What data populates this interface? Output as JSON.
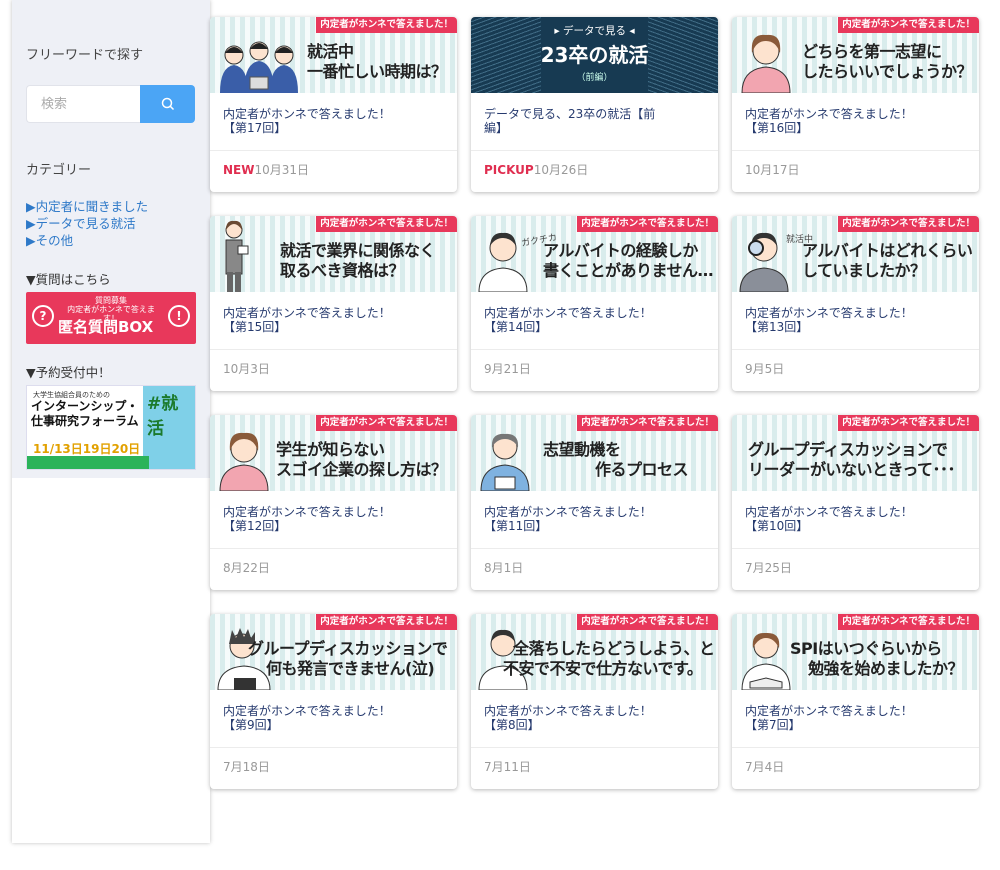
{
  "sidebar": {
    "search_heading": "フリーワードで探す",
    "search_placeholder": "検索",
    "category_heading": "カテゴリー",
    "categories": [
      "▶内定者に聞きました",
      "▶データで見る就活",
      "▶その他"
    ],
    "question_heading": "▼質問はこちら",
    "question_banner": {
      "small_line1": "質問募集",
      "small_line2": "内定者がホンネで答えます！",
      "title": "匿名質問BOX",
      "mark": "?",
      "mark_right": "!"
    },
    "reservation_heading": "▼予約受付中！",
    "forum_banner": {
      "line1": "大学生協組合員のための",
      "line2": "インターンシップ・",
      "line3": "仕事研究フォーラム",
      "dates": "11/13日19日20日",
      "tag": "#就活"
    }
  },
  "ribbon_text": "内定者がホンネで答えました！",
  "cards": [
    {
      "title_lines": [
        "就活中",
        "一番忙しい時期は？"
      ],
      "excerpt_l1": "内定者がホンネで答えました！",
      "excerpt_l2": "【第17回】",
      "badge": "NEW",
      "date": "10月31日"
    },
    {
      "dark": true,
      "dark_sub": "▸ データで見る ◂",
      "dark_main": "23卒の就活",
      "dark_tail": "（前編）",
      "excerpt_l1": "データで見る、23卒の就活【前",
      "excerpt_l2": "編】",
      "badge": "PICKUP",
      "date": "10月26日"
    },
    {
      "title_lines": [
        "どちらを第一志望に",
        "したらいいでしょうか？"
      ],
      "excerpt_l1": "内定者がホンネで答えました！",
      "excerpt_l2": "【第16回】",
      "badge": "",
      "date": "10月17日"
    },
    {
      "title_lines": [
        "就活で業界に関係なく",
        "取るべき資格は？"
      ],
      "excerpt_l1": "内定者がホンネで答えました！",
      "excerpt_l2": "【第15回】",
      "badge": "",
      "date": "10月3日"
    },
    {
      "title_lines": [
        "アルバイトの経験しか",
        "書くことがありません…"
      ],
      "tag": "ガクチカ",
      "excerpt_l1": "内定者がホンネで答えました！",
      "excerpt_l2": "【第14回】",
      "badge": "",
      "date": "9月21日"
    },
    {
      "title_lines": [
        "アルバイトはどれくらい",
        "していましたか？"
      ],
      "tag": "就活中",
      "excerpt_l1": "内定者がホンネで答えました！",
      "excerpt_l2": "【第13回】",
      "badge": "",
      "date": "9月5日"
    },
    {
      "title_lines": [
        "学生が知らない",
        "スゴイ企業の探し方は？"
      ],
      "excerpt_l1": "内定者がホンネで答えました！",
      "excerpt_l2": "【第12回】",
      "badge": "",
      "date": "8月22日"
    },
    {
      "title_lines": [
        "志望動機を",
        "作るプロセス"
      ],
      "excerpt_l1": "内定者がホンネで答えました！",
      "excerpt_l2": "【第11回】",
      "badge": "",
      "date": "8月1日"
    },
    {
      "title_lines": [
        "グループディスカッションで",
        "リーダーがいないときって･･･"
      ],
      "excerpt_l1": "内定者がホンネで答えました！",
      "excerpt_l2": "【第10回】",
      "badge": "",
      "date": "7月25日"
    },
    {
      "title_lines": [
        "グループディスカッションで",
        "何も発言できません(泣)"
      ],
      "excerpt_l1": "内定者がホンネで答えました！",
      "excerpt_l2": "【第9回】",
      "badge": "",
      "date": "7月18日"
    },
    {
      "title_lines": [
        "全落ちしたらどうしよう、と",
        "不安で不安で仕方ないです。"
      ],
      "excerpt_l1": "内定者がホンネで答えました！",
      "excerpt_l2": "【第8回】",
      "badge": "",
      "date": "7月11日"
    },
    {
      "title_lines": [
        "SPIはいつぐらいから",
        "勉強を始めましたか？"
      ],
      "excerpt_l1": "内定者がホンネで答えました！",
      "excerpt_l2": "【第7回】",
      "badge": "",
      "date": "7月4日"
    }
  ],
  "colors": {
    "accent_red": "#e8385b",
    "link_blue": "#2e79c8",
    "search_blue": "#4ba5f5",
    "excerpt_navy": "#263a6e",
    "sidebar_bg": "#eef0f6"
  }
}
